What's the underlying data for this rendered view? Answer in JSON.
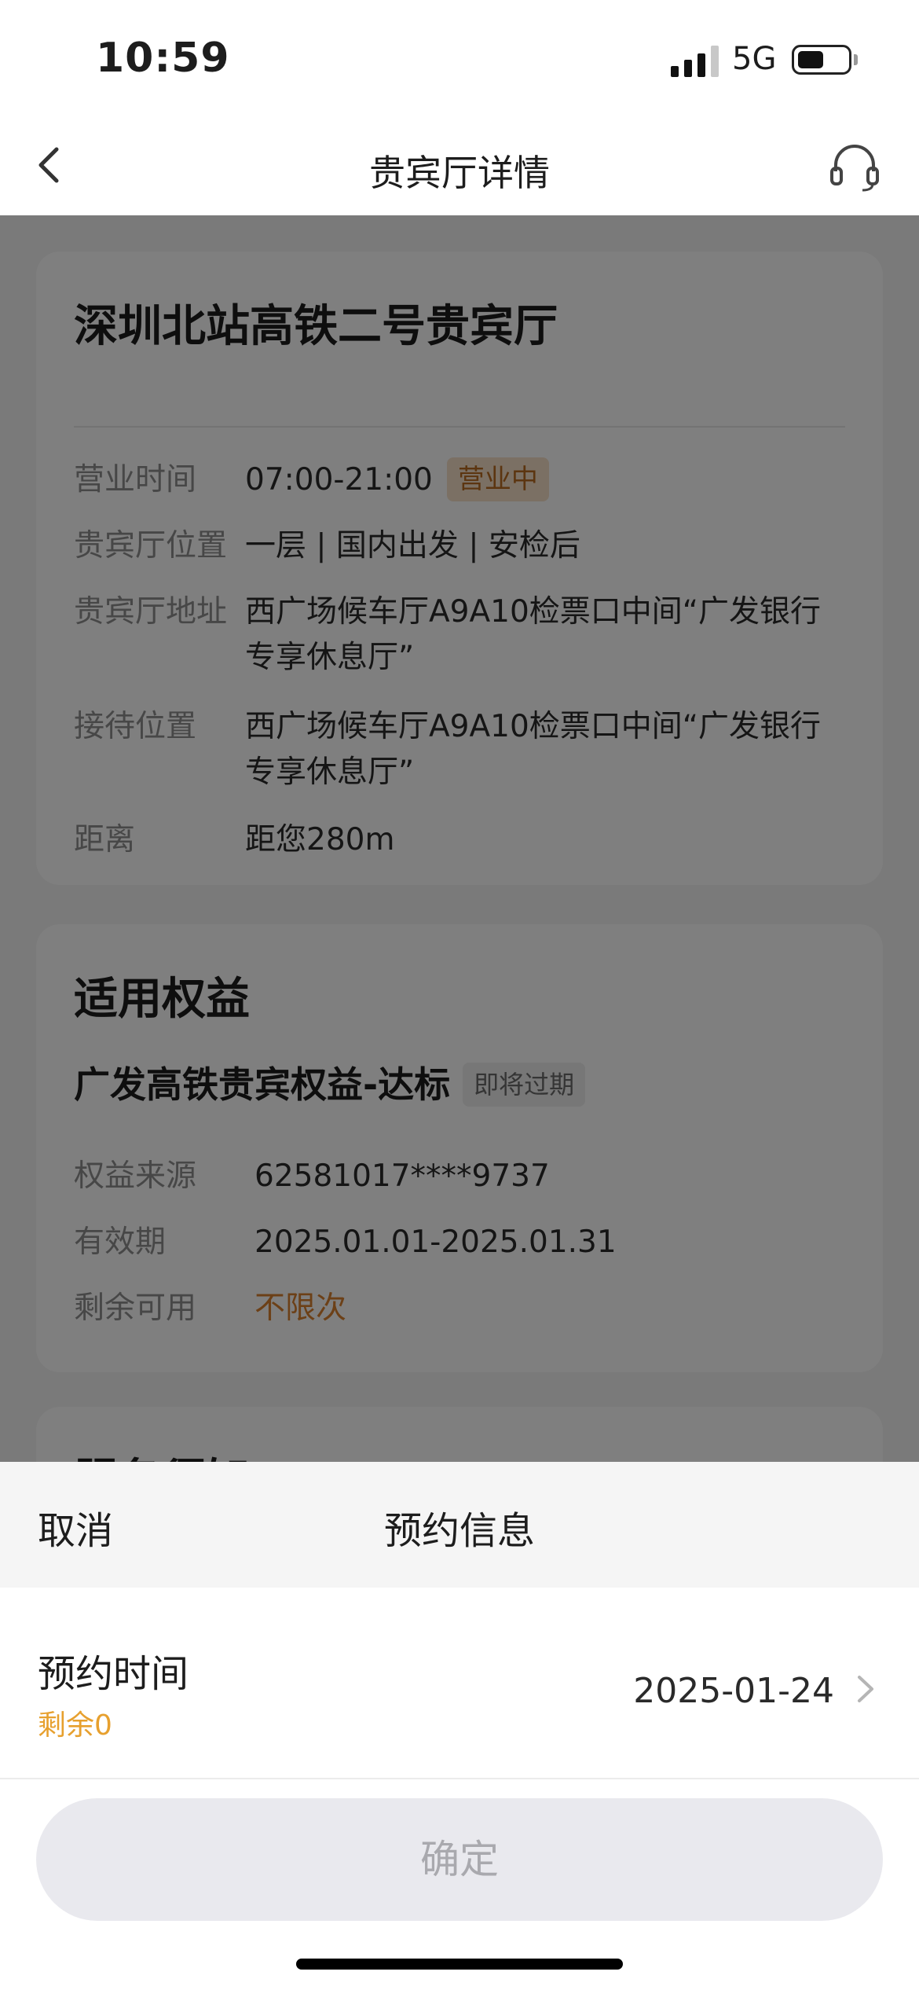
{
  "status_bar": {
    "time": "10:59",
    "network": "5G"
  },
  "nav": {
    "title": "贵宾厅详情"
  },
  "hall": {
    "name": "深圳北站高铁二号贵宾厅",
    "rows": {
      "hours": {
        "label": "营业时间",
        "value": "07:00-21:00",
        "badge": "营业中"
      },
      "position": {
        "label": "贵宾厅位置",
        "value": "一层 | 国内出发 | 安检后"
      },
      "address": {
        "label": "贵宾厅地址",
        "value": "西广场候车厅A9A10检票口中间“广发银行专享休息厅”"
      },
      "reception": {
        "label": "接待位置",
        "value": "西广场候车厅A9A10检票口中间“广发银行专享休息厅”"
      },
      "distance": {
        "label": "距离",
        "value": "距您280m"
      }
    }
  },
  "benefit": {
    "heading": "适用权益",
    "name": "广发高铁贵宾权益-达标",
    "badge": "即将过期",
    "rows": {
      "source": {
        "label": "权益来源",
        "value": "62581017****9737"
      },
      "validity": {
        "label": "有效期",
        "value": "2025.01.01-2025.01.31"
      },
      "remaining": {
        "label": "剩余可用",
        "value": "不限次"
      }
    }
  },
  "notice": {
    "heading": "服务须知"
  },
  "sheet": {
    "cancel": "取消",
    "title": "预约信息",
    "time_label": "预约时间",
    "remain": "剩余0",
    "date": "2025-01-24",
    "confirm": "确定"
  },
  "colors": {
    "accent_orange": "#d9802f",
    "remain_yellow": "#e7a02e",
    "overlay": "rgba(0,0,0,0.5)",
    "confirm_disabled_bg": "#e9e9ee"
  },
  "icons": [
    "back-icon",
    "headset-icon",
    "signal-icon",
    "battery-icon",
    "chevron-right-icon"
  ]
}
